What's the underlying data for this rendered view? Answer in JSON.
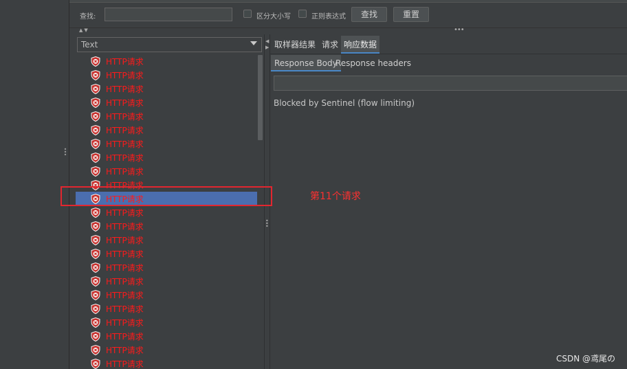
{
  "search": {
    "label": "查找:",
    "input_value": "",
    "case_label": "区分大小写",
    "regex_label": "正则表达式",
    "find_button": "查找",
    "reset_button": "重置"
  },
  "left": {
    "renderer_selected": "Text",
    "item_label": "HTTP请求",
    "item_count": 23,
    "selected_index": 10,
    "items": [
      "HTTP请求",
      "HTTP请求",
      "HTTP请求",
      "HTTP请求",
      "HTTP请求",
      "HTTP请求",
      "HTTP请求",
      "HTTP请求",
      "HTTP请求",
      "HTTP请求",
      "HTTP请求",
      "HTTP请求",
      "HTTP请求",
      "HTTP请求",
      "HTTP请求",
      "HTTP请求",
      "HTTP请求",
      "HTTP请求",
      "HTTP请求",
      "HTTP请求",
      "HTTP请求",
      "HTTP请求",
      "HTTP请求"
    ]
  },
  "right": {
    "tabs": [
      "取样器结果",
      "请求",
      "响应数据"
    ],
    "active_tab": "响应数据",
    "subtabs": [
      "Response Body",
      "Response headers"
    ],
    "active_subtab": "Response Body",
    "response_search_value": "",
    "response_body": "Blocked by Sentinel (flow limiting)"
  },
  "annotation": {
    "text": "第11个请求"
  },
  "watermark": {
    "text": "CSDN @鸢尾の"
  },
  "colors": {
    "background": "#3c3f41",
    "error_text": "#ff1a1a",
    "selection": "#4b6eaf",
    "highlight_box": "#e3262f",
    "tab_underline": "#4a88c7"
  },
  "icons": {
    "tree_item": "error-shield-icon",
    "combo": "chevron-down-icon"
  }
}
